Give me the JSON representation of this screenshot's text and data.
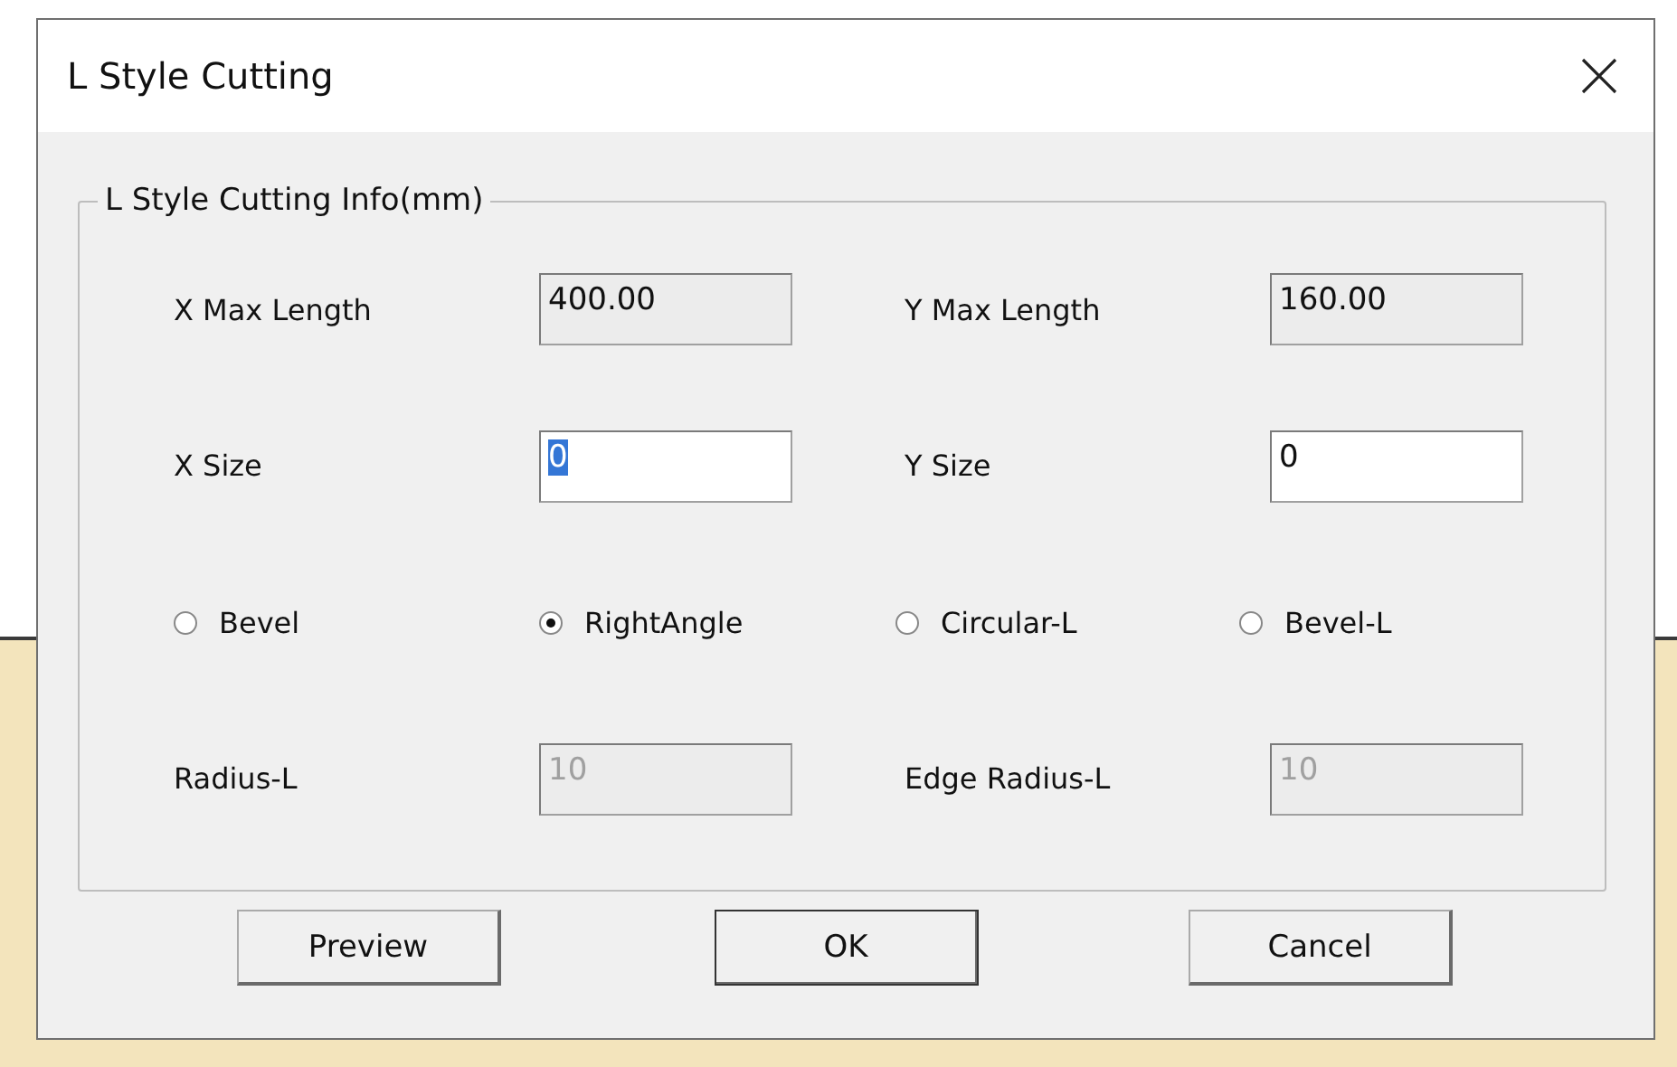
{
  "window": {
    "title": "L Style Cutting"
  },
  "group": {
    "title": "L Style Cutting Info(mm)",
    "rows": [
      {
        "kind": "fields",
        "items": [
          {
            "kind": "readonly",
            "label": "X Max Length",
            "value": "400.00",
            "focused": false
          },
          {
            "kind": "readonly",
            "label": "Y Max Length",
            "value": "160.00",
            "focused": false
          }
        ]
      },
      {
        "kind": "fields",
        "items": [
          {
            "kind": "editable",
            "label": "X Size",
            "value": "0",
            "focused": true
          },
          {
            "kind": "editable",
            "label": "Y Size",
            "value": "0",
            "focused": false
          }
        ]
      },
      {
        "kind": "radios",
        "options": [
          {
            "label": "Bevel",
            "selected": false
          },
          {
            "label": "RightAngle",
            "selected": true
          },
          {
            "label": "Circular-L",
            "selected": false
          },
          {
            "label": "Bevel-L",
            "selected": false
          }
        ]
      },
      {
        "kind": "fields",
        "items": [
          {
            "kind": "disabled",
            "label": "Radius-L",
            "value": "10",
            "focused": false
          },
          {
            "kind": "disabled",
            "label": "Edge Radius-L",
            "value": "10",
            "focused": false
          }
        ]
      }
    ]
  },
  "buttons": [
    {
      "label": "Preview",
      "default": false
    },
    {
      "label": "OK",
      "default": true
    },
    {
      "label": "Cancel",
      "default": false
    }
  ]
}
